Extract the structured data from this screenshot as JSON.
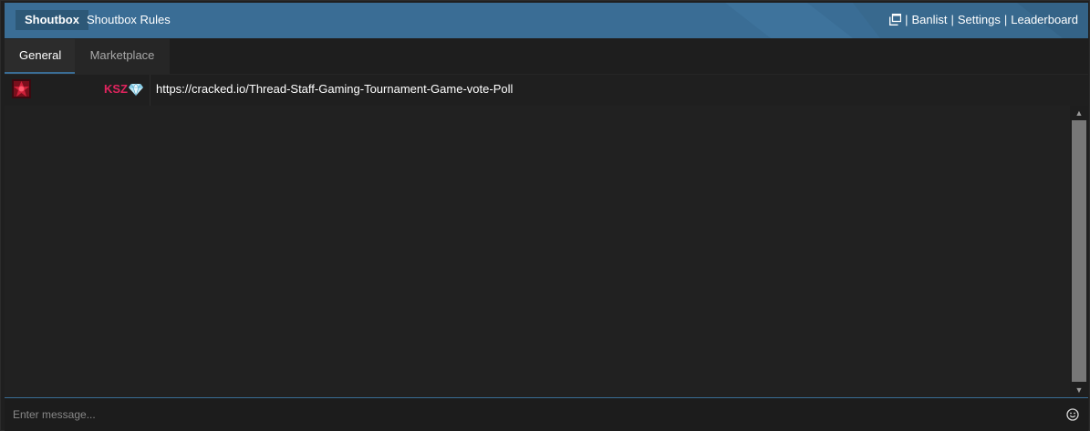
{
  "header": {
    "title": "Shoutbox",
    "rules_link": "Shoutbox Rules",
    "separator": "|",
    "links": {
      "banlist": "Banlist",
      "settings": "Settings",
      "leaderboard": "Leaderboard"
    },
    "popout_icon": "popout-window-icon",
    "color": "#3a6d95"
  },
  "tabs": [
    {
      "label": "General",
      "active": true
    },
    {
      "label": "Marketplace",
      "active": false
    }
  ],
  "messages": [
    {
      "avatar_icon": "red-avatar",
      "username": "KSZ",
      "username_color": "#e0245e",
      "badge_icon": "diamond-icon",
      "text": "https://cracked.io/Thread-Staff-Gaming-Tournament-Game-vote-Poll"
    }
  ],
  "input": {
    "placeholder": "Enter message...",
    "value": "",
    "emoji_icon": "smiley-icon"
  }
}
